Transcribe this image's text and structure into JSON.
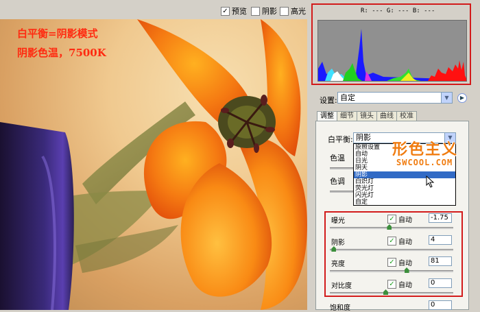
{
  "toolbar": {
    "preview": {
      "label": "预览",
      "checked": true
    },
    "shadows": {
      "label": "阴影",
      "checked": false
    },
    "highlights": {
      "label": "高光",
      "checked": false
    }
  },
  "overlay": {
    "line1": "白平衡=阴影模式",
    "line2": "阴影色温，7500K"
  },
  "histogram": {
    "rgb_readout": "R: ---  G: ---  B: ---"
  },
  "settings": {
    "label": "设置:",
    "value": "自定"
  },
  "tabs": [
    {
      "label": "调整",
      "active": true
    },
    {
      "label": "细节",
      "active": false
    },
    {
      "label": "镜头",
      "active": false
    },
    {
      "label": "曲线",
      "active": false
    },
    {
      "label": "校准",
      "active": false
    }
  ],
  "white_balance": {
    "label": "白平衡:",
    "value": "阴影",
    "options": [
      "原照设置",
      "自动",
      "日光",
      "阴天",
      "阴影",
      "白炽灯",
      "荧光灯",
      "闪光灯",
      "自定"
    ],
    "selected_index": 4,
    "temperature_label": "色温",
    "tint_label": "色调"
  },
  "watermark": {
    "main": "形色主义",
    "sub": "SWCOOL.COM"
  },
  "adjustments": [
    {
      "label": "曝光",
      "auto_label": "自动",
      "auto": true,
      "value": "-1.75",
      "slider": 0.48
    },
    {
      "label": "阴影",
      "auto_label": "自动",
      "auto": true,
      "value": "4",
      "slider": 0.03
    },
    {
      "label": "亮度",
      "auto_label": "自动",
      "auto": true,
      "value": "81",
      "slider": 0.62
    },
    {
      "label": "对比度",
      "auto_label": "自动",
      "auto": true,
      "value": "0",
      "slider": 0.45
    }
  ],
  "saturation": {
    "label": "饱和度",
    "value": "0"
  },
  "colors": {
    "highlight_frame": "#d21a1a",
    "overlay_text": "#ff2a10",
    "watermark": "#f07c10",
    "selection": "#316ac5"
  },
  "icons": {
    "settings_menu": "circle-arrow-right-icon",
    "dropdown": "chevron-down-icon",
    "checkbox": "checkmark-icon"
  }
}
